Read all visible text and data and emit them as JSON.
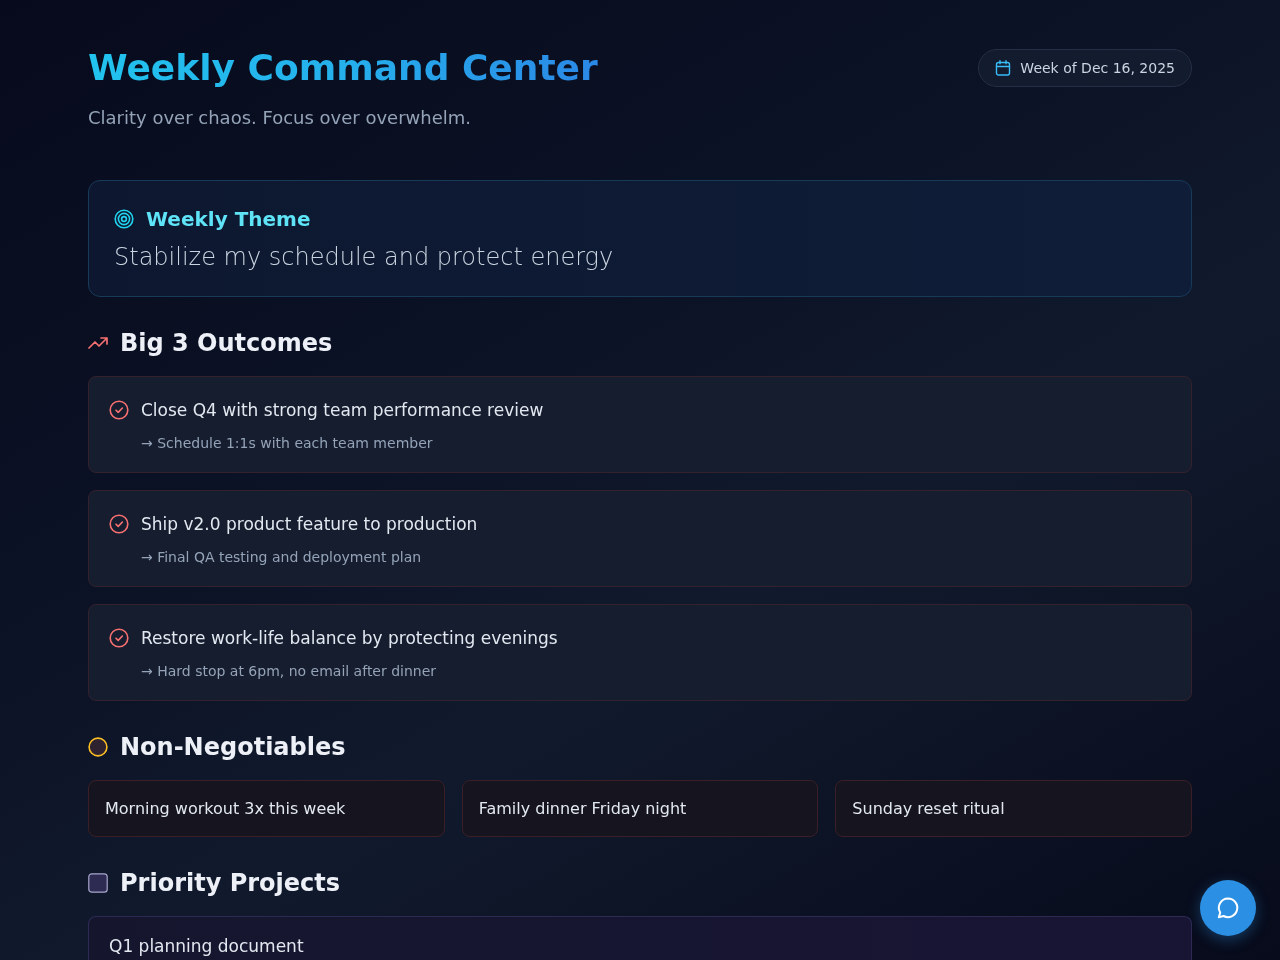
{
  "header": {
    "title": "Weekly Command Center",
    "subtitle": "Clarity over chaos. Focus over overwhelm.",
    "week_badge": "Week of Dec 16, 2025"
  },
  "theme": {
    "heading": "Weekly Theme",
    "text": "Stabilize my schedule and protect energy"
  },
  "outcomes": {
    "heading": "Big 3 Outcomes",
    "items": [
      {
        "title": "Close Q4 with strong team performance review",
        "next_step": "→ Schedule 1:1s with each team member"
      },
      {
        "title": "Ship v2.0 product feature to production",
        "next_step": "→ Final QA testing and deployment plan"
      },
      {
        "title": "Restore work-life balance by protecting evenings",
        "next_step": "→ Hard stop at 6pm, no email after dinner"
      }
    ]
  },
  "non_negotiables": {
    "heading": "Non-Negotiables",
    "items": [
      "Morning workout 3x this week",
      "Family dinner Friday night",
      "Sunday reset ritual"
    ]
  },
  "priority_projects": {
    "heading": "Priority Projects",
    "items": [
      {
        "title": "Q1 planning document"
      }
    ]
  }
}
